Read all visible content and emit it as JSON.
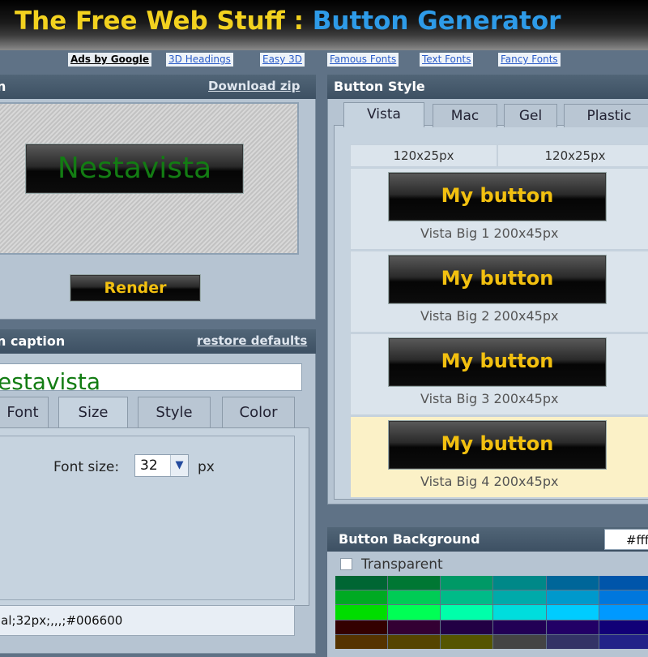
{
  "header": {
    "title_part1": "The Free Web Stuff : ",
    "title_part2": "Button Generator"
  },
  "linkbar": {
    "ads": "Ads by Google",
    "links": [
      "3D Headings",
      "Easy 3D",
      "Famous Fonts",
      "Text Fonts",
      "Fancy Fonts"
    ]
  },
  "left": {
    "preview_title": "n",
    "download_label": "Download zip",
    "preview_button_text": "Nestavista",
    "render_label": "Render",
    "caption_title": "n caption",
    "restore_label": "restore defaults",
    "caption_value": "estavista",
    "tabs": [
      "Font",
      "Size",
      "Style",
      "Color"
    ],
    "font_size_label": "Font size:",
    "font_size_value": "32",
    "px_label": "px",
    "code_string": "ial;32px;,,,;#006600"
  },
  "right": {
    "style_title": "Button Style",
    "tabs": [
      "Vista",
      "Mac",
      "Gel",
      "Plastic"
    ],
    "size_cells": [
      "120x25px",
      "120x25px"
    ],
    "cards": [
      {
        "button_text": "My button",
        "caption": "Vista Big 1    200x45px"
      },
      {
        "button_text": "My button",
        "caption": "Vista Big 2    200x45px"
      },
      {
        "button_text": "My button",
        "caption": "Vista Big 3    200x45px"
      },
      {
        "button_text": "My button",
        "caption": "Vista Big 4    200x45px"
      }
    ],
    "background_title": "Button Background",
    "background_value": "#fff",
    "transparent_label": "Transparent",
    "palette": [
      "#006633",
      "#007733",
      "#009966",
      "#008888",
      "#006699",
      "#0055aa",
      "#00aa22",
      "#00cc55",
      "#00bb88",
      "#00aaaa",
      "#0099cc",
      "#0077dd",
      "#00dd00",
      "#00ff55",
      "#00ffaa",
      "#00dddd",
      "#00ccff",
      "#0099ff",
      "#330000",
      "#330033",
      "#220044",
      "#220055",
      "#220066",
      "#110077",
      "#553300",
      "#554400",
      "#555500",
      "#444444",
      "#333366",
      "#222288"
    ]
  }
}
